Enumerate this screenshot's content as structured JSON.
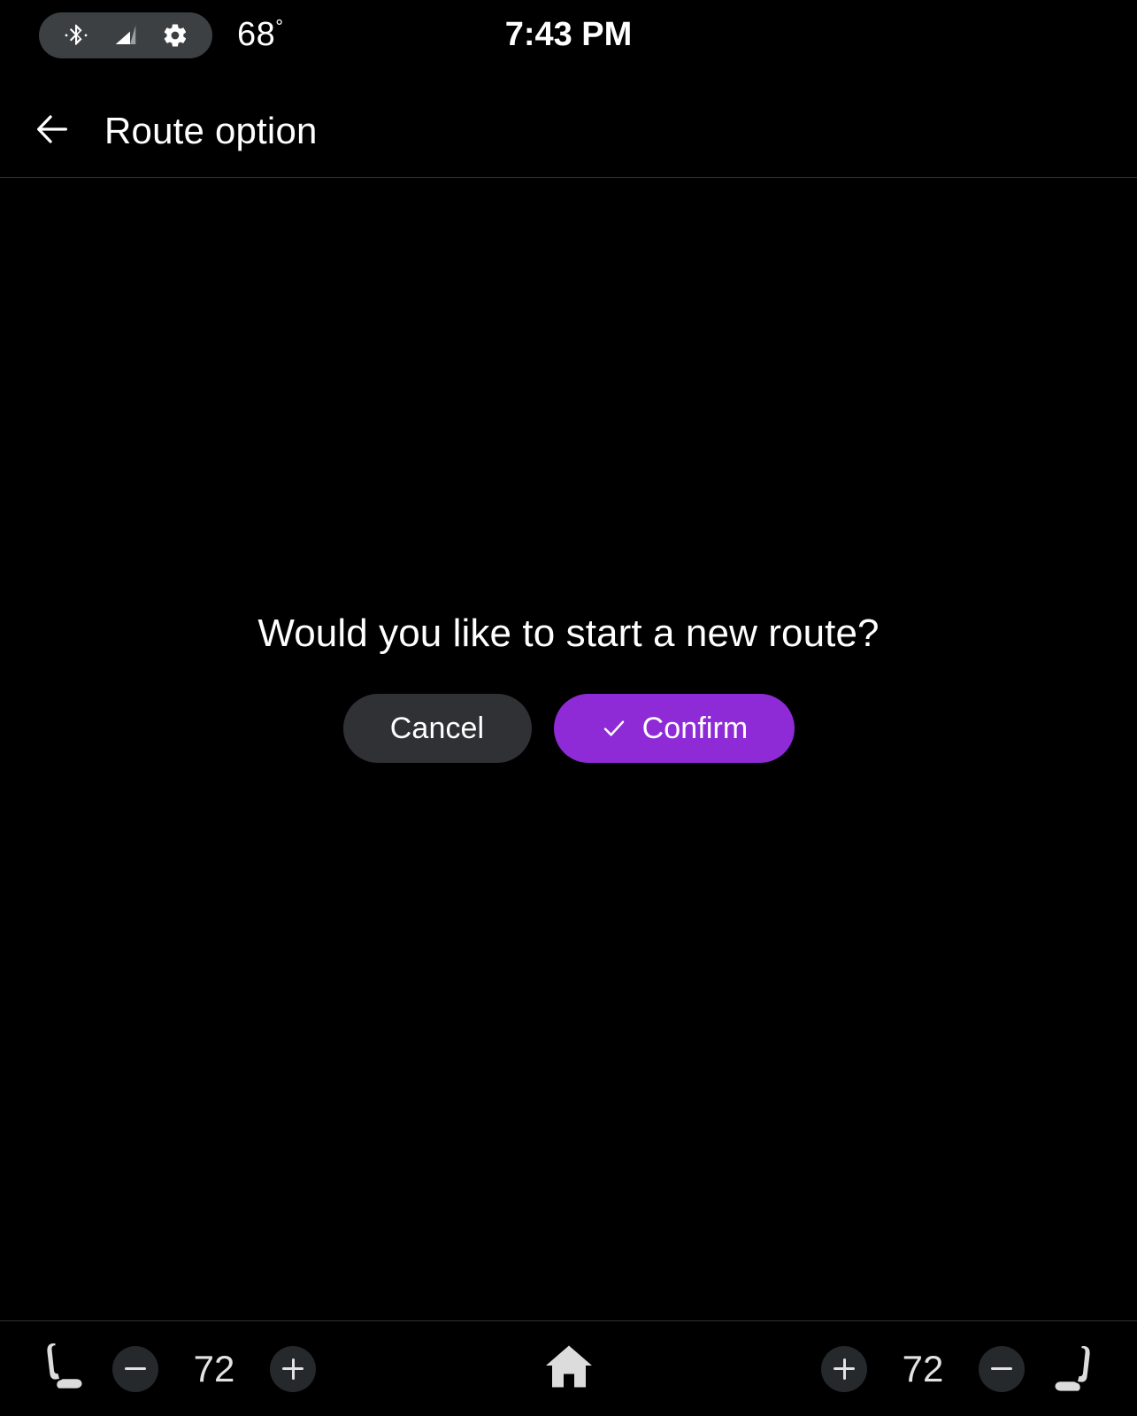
{
  "status_bar": {
    "bluetooth_icon": "bluetooth-icon",
    "signal_icon": "signal-bars-icon",
    "settings_icon": "gear-icon",
    "temperature": "68",
    "degree_symbol": "°",
    "clock": "7:43 PM"
  },
  "app_bar": {
    "back_icon": "arrow-left-icon",
    "title": "Route option"
  },
  "dialog": {
    "message": "Would you like to start a new route?",
    "cancel_label": "Cancel",
    "confirm_label": "Confirm",
    "confirm_icon": "check-icon",
    "confirm_color": "#8e2bd6",
    "cancel_color": "#303134"
  },
  "bottom_bar": {
    "home_icon": "home-icon",
    "left_climate": {
      "seat_icon": "car-seat-icon",
      "decrease_icon": "minus-icon",
      "value": "72",
      "increase_icon": "plus-icon"
    },
    "right_climate": {
      "increase_icon": "plus-icon",
      "value": "72",
      "decrease_icon": "minus-icon",
      "seat_icon": "car-seat-icon"
    }
  }
}
